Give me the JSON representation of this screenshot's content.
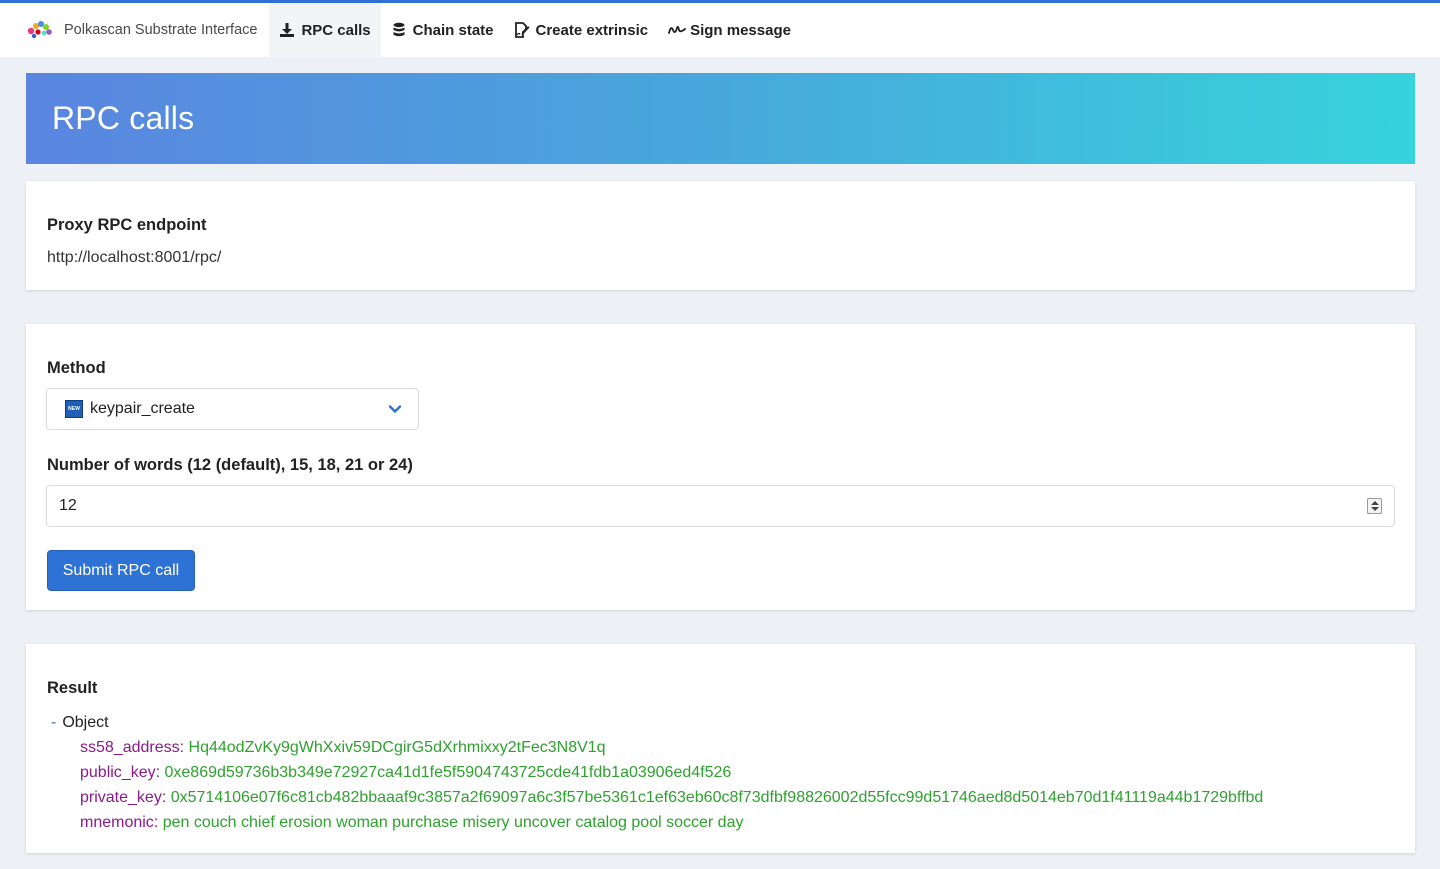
{
  "brand": {
    "name": "Polkascan Substrate Interface"
  },
  "nav": {
    "items": [
      {
        "label": "RPC calls",
        "icon": "download-icon",
        "active": true
      },
      {
        "label": "Chain state",
        "icon": "database-icon",
        "active": false
      },
      {
        "label": "Create extrinsic",
        "icon": "file-signature-icon",
        "active": false
      },
      {
        "label": "Sign message",
        "icon": "signature-icon",
        "active": false
      }
    ]
  },
  "hero": {
    "title": "RPC calls"
  },
  "endpoint_card": {
    "label": "Proxy RPC endpoint",
    "url": "http://localhost:8001/rpc/"
  },
  "form": {
    "method_label": "Method",
    "method_value": "keypair_create",
    "method_badge": "NEW",
    "words_label": "Number of words (12 (default), 15, 18, 21 or 24)",
    "words_value": "12",
    "submit_label": "Submit RPC call"
  },
  "result": {
    "label": "Result",
    "toggle": "-",
    "root": "Object",
    "fields": [
      {
        "key": "ss58_address",
        "value": "Hq44odZvKy9gWhXxiv59DCgirG5dXrhmixxy2tFec3N8V1q"
      },
      {
        "key": "public_key",
        "value": "0xe869d59736b3b349e72927ca41d1fe5f5904743725cde41fdb1a03906ed4f526"
      },
      {
        "key": "private_key",
        "value": "0x5714106e07f6c81cb482bbaaaf9c3857a2f69097a6c3f57be5361c1ef63eb60c8f73dfbf98826002d55fcc99d51746aed8d5014eb70d1f41119a44b1729bffbd"
      },
      {
        "key": "mnemonic",
        "value": "pen couch chief erosion woman purchase misery uncover catalog pool soccer day"
      }
    ]
  },
  "colors": {
    "accent": "#2f72d6",
    "hero_start": "#5a85e0",
    "hero_end": "#36d3dc",
    "tree_key": "#8b1a8b",
    "tree_value": "#2ea12e"
  }
}
